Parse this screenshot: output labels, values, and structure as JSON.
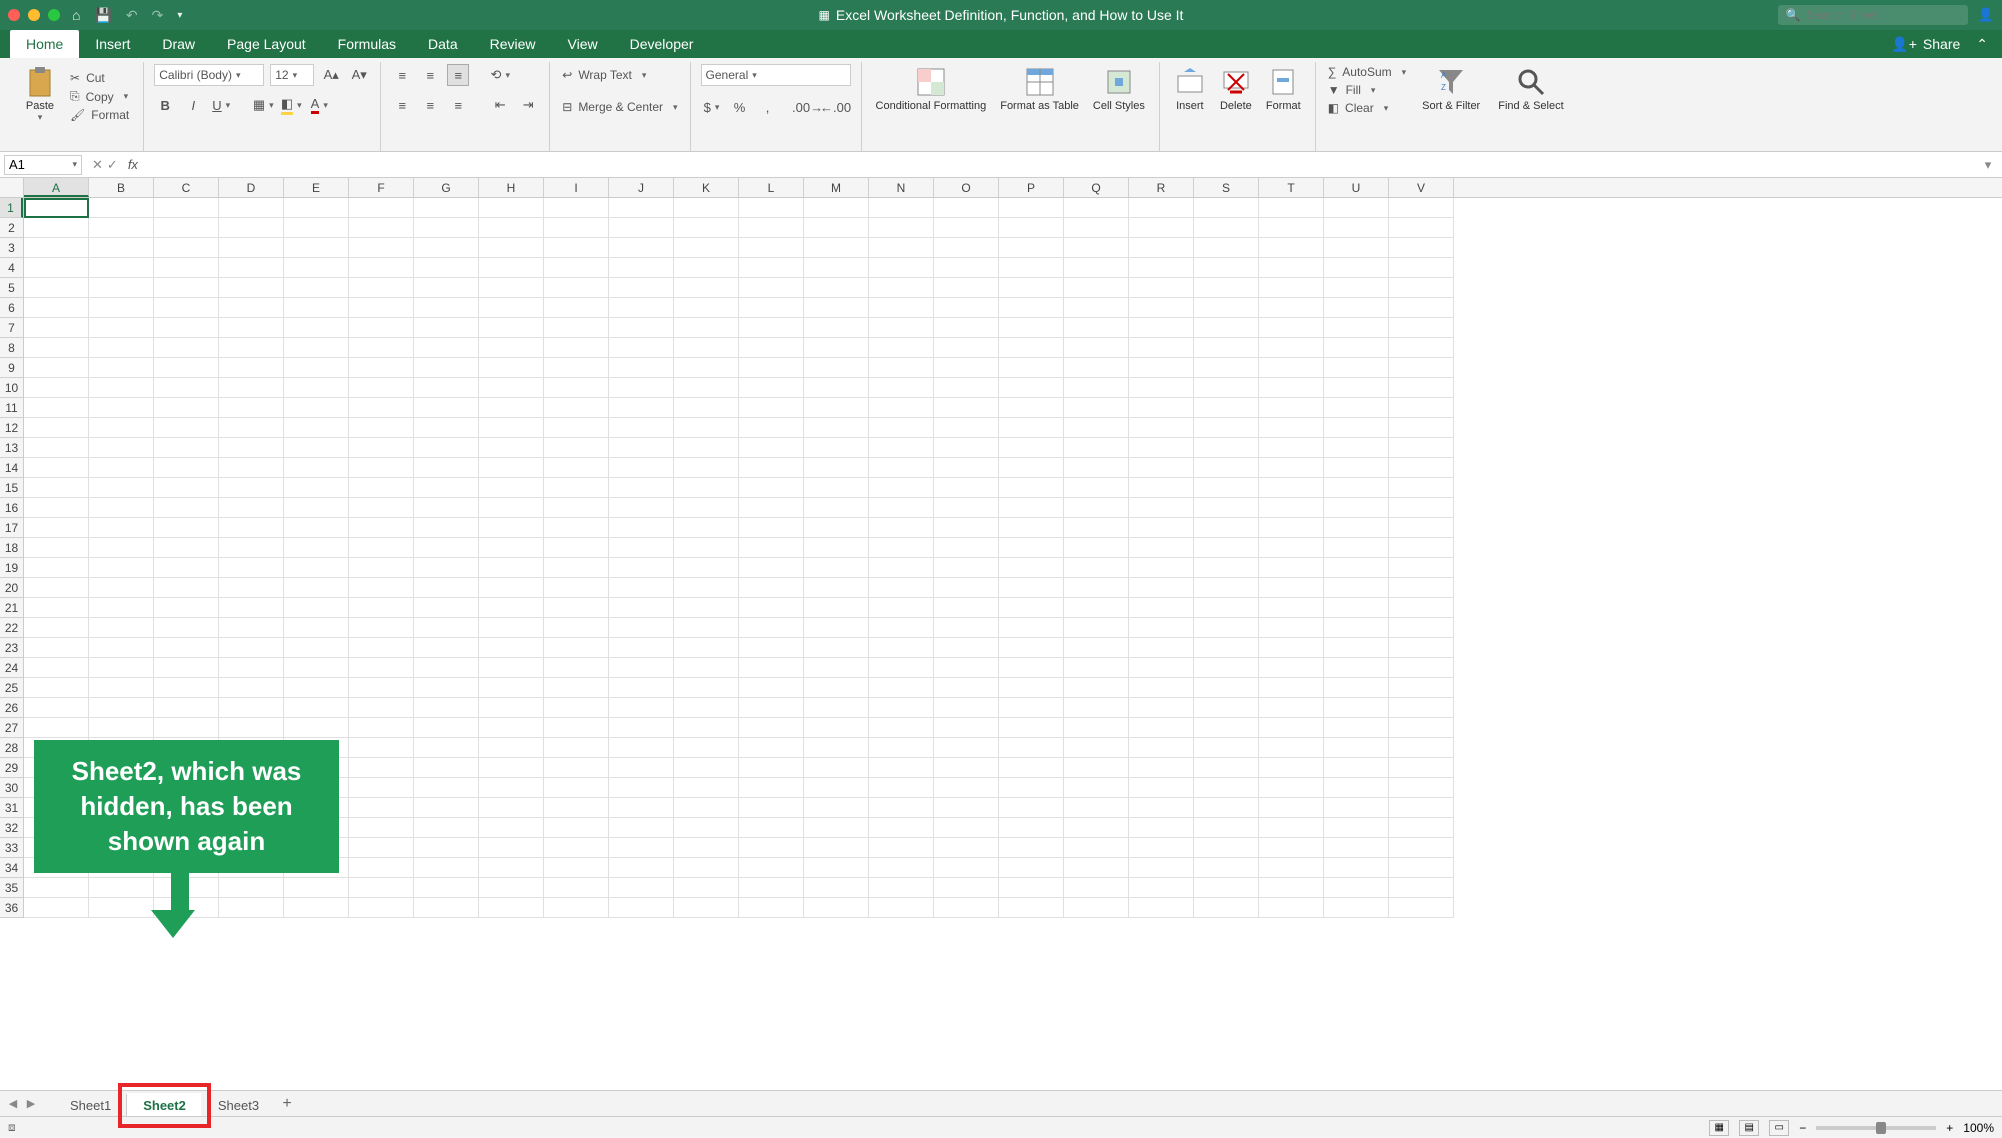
{
  "titlebar": {
    "title": "Excel Worksheet Definition, Function, and How to Use It",
    "search_placeholder": "Search Sheet"
  },
  "menu": {
    "tabs": [
      {
        "label": "Home",
        "active": true
      },
      {
        "label": "Insert"
      },
      {
        "label": "Draw"
      },
      {
        "label": "Page Layout"
      },
      {
        "label": "Formulas"
      },
      {
        "label": "Data"
      },
      {
        "label": "Review"
      },
      {
        "label": "View"
      },
      {
        "label": "Developer"
      }
    ],
    "share": "Share"
  },
  "ribbon": {
    "clipboard": {
      "paste": "Paste",
      "cut": "Cut",
      "copy": "Copy",
      "format": "Format"
    },
    "font": {
      "name": "Calibri (Body)",
      "size": "12"
    },
    "align": {
      "wrap": "Wrap Text",
      "merge": "Merge & Center"
    },
    "number": {
      "format": "General"
    },
    "styles": {
      "cond": "Conditional Formatting",
      "table": "Format as Table",
      "cell": "Cell Styles"
    },
    "cells": {
      "insert": "Insert",
      "delete": "Delete",
      "format": "Format"
    },
    "editing": {
      "autosum": "AutoSum",
      "fill": "Fill",
      "clear": "Clear",
      "sort": "Sort & Filter",
      "find": "Find & Select"
    }
  },
  "formula_bar": {
    "name_box": "A1"
  },
  "grid": {
    "columns": [
      "A",
      "B",
      "C",
      "D",
      "E",
      "F",
      "G",
      "H",
      "I",
      "J",
      "K",
      "L",
      "M",
      "N",
      "O",
      "P",
      "Q",
      "R",
      "S",
      "T",
      "U",
      "V"
    ],
    "rows_count": 36,
    "active_cell": {
      "row": 1,
      "col": "A"
    }
  },
  "sheet_tabs": {
    "tabs": [
      {
        "label": "Sheet1"
      },
      {
        "label": "Sheet2",
        "active": true,
        "highlighted": true
      },
      {
        "label": "Sheet3"
      }
    ]
  },
  "statusbar": {
    "zoom": "100%"
  },
  "annotation": {
    "text": "Sheet2, which was hidden, has been shown again"
  }
}
